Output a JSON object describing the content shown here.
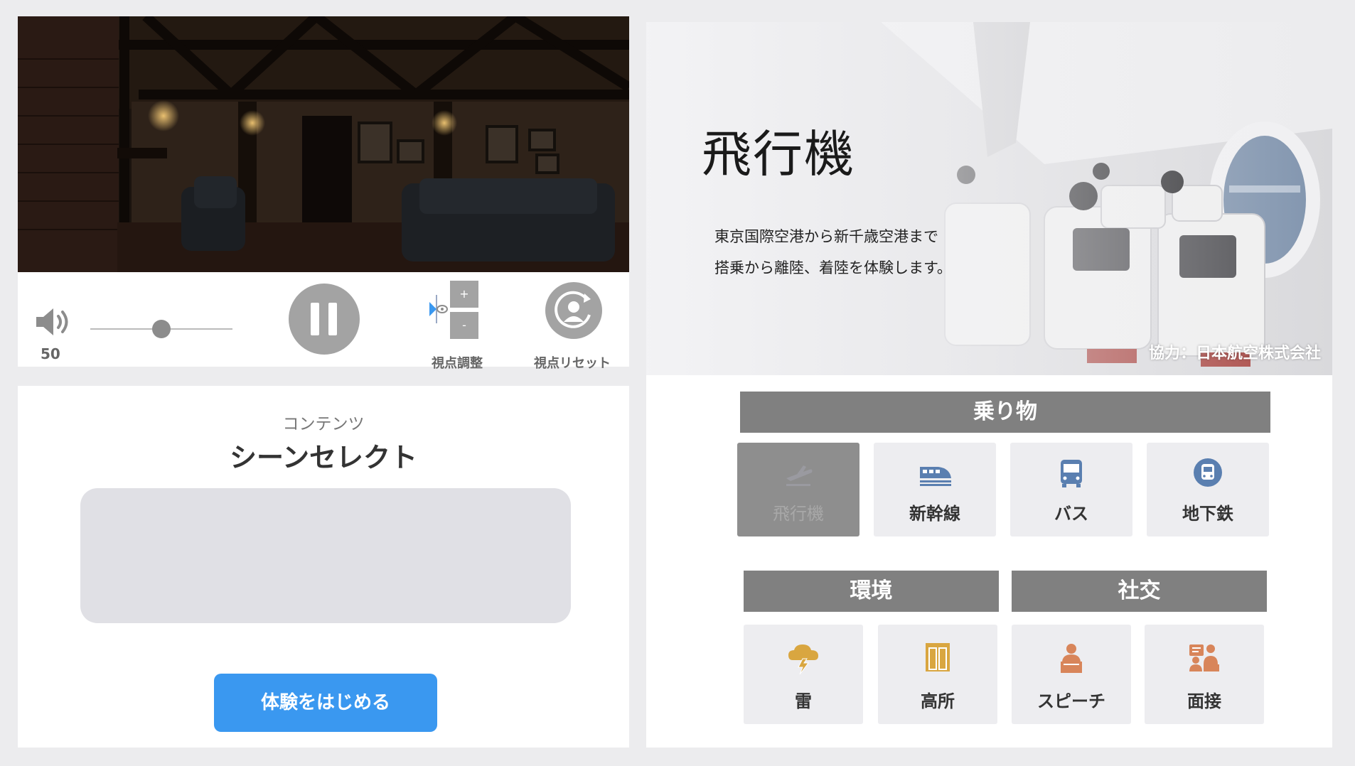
{
  "player": {
    "volume": {
      "value": "50",
      "level": 0.5
    },
    "viewpoint_adjust": {
      "label": "視点調整",
      "plus": "+",
      "minus": "-"
    },
    "viewpoint_reset": {
      "label": "視点リセット"
    }
  },
  "scene_select": {
    "subtitle": "コンテンツ",
    "title": "シーンセレクト",
    "start_button": "体験をはじめる"
  },
  "hero": {
    "title": "飛行機",
    "description_line1": "東京国際空港から新千歳空港まで",
    "description_line2": "搭乗から離陸、着陸を体験します。",
    "credit": "協力：日本航空株式会社"
  },
  "categories": {
    "vehicles": {
      "label": "乗り物",
      "items": [
        {
          "label": "飛行機",
          "icon": "airplane-icon",
          "selected": true
        },
        {
          "label": "新幹線",
          "icon": "bullet-train-icon"
        },
        {
          "label": "バス",
          "icon": "bus-icon"
        },
        {
          "label": "地下鉄",
          "icon": "subway-icon"
        }
      ]
    },
    "environment": {
      "label": "環境",
      "items": [
        {
          "label": "雷",
          "icon": "thunder-cloud-icon"
        },
        {
          "label": "高所",
          "icon": "elevator-icon"
        }
      ]
    },
    "social": {
      "label": "社交",
      "items": [
        {
          "label": "スピーチ",
          "icon": "speech-podium-icon"
        },
        {
          "label": "面接",
          "icon": "interview-icon"
        }
      ]
    }
  },
  "colors": {
    "accent_blue": "#3a98f0",
    "category_header": "#808080",
    "vehicle_icon": "#5a7fb0",
    "environment_icon": "#d9a640",
    "social_icon": "#d8855a"
  }
}
